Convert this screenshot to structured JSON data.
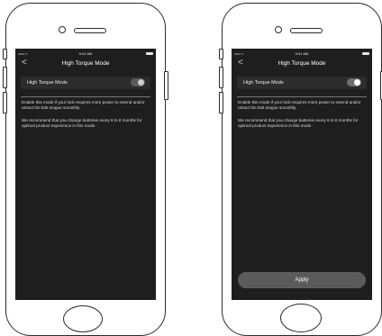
{
  "status": {
    "signal": "••••• ≈",
    "time": "9:41 AM"
  },
  "nav": {
    "back_glyph": "<",
    "title": "High Torque Mode"
  },
  "setting": {
    "label": "High Torque Mode"
  },
  "description": {
    "p1": "Enable this mode if your lock requires more power to extend and/or retract the bolt tongue smoothly.",
    "p2": "We recommend that you change batteries every 6 to 8 months for optimal product experience in this mode."
  },
  "left_screen": {
    "toggle_state": "off"
  },
  "right_screen": {
    "toggle_state": "on",
    "apply_label": "Apply"
  }
}
